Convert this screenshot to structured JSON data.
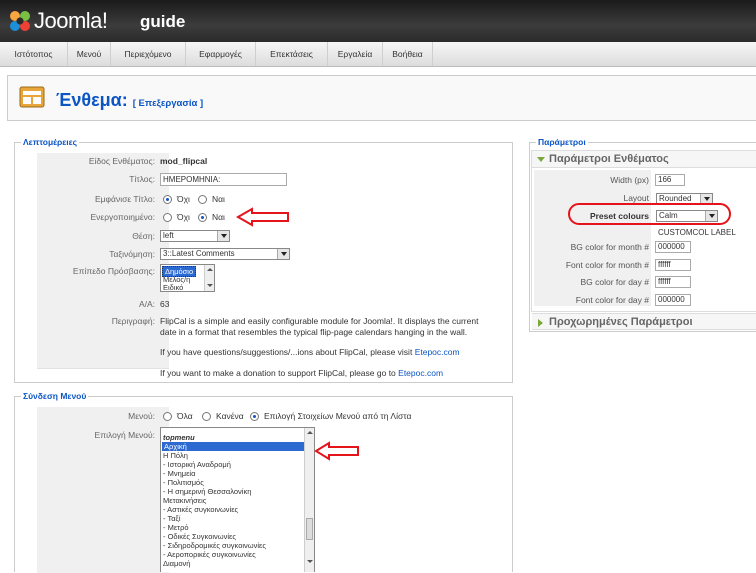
{
  "header": {
    "logo_text": "Joomla!",
    "site_title": "guide"
  },
  "menu": {
    "items": [
      "Ιστότοπος",
      "Μενού",
      "Περιεχόμενο",
      "Εφαρμογές",
      "Επεκτάσεις",
      "Εργαλεία",
      "Βοήθεια"
    ]
  },
  "toolbar": {
    "title": "Ένθεμα:",
    "subtitle": "[ Επεξεργασία ]"
  },
  "details": {
    "legend": "Λεπτομέρειες",
    "type_label": "Είδος Ενθέματος:",
    "type_value": "mod_flipcal",
    "title_label": "Τίτλος:",
    "title_value": "ΗΜΕΡΟΜΗΝΙΑ:",
    "show_title_label": "Εμφάνισε Τίτλο:",
    "enabled_label": "Ενεργοποιημένο:",
    "radio_no": "Όχι",
    "radio_yes": "Ναι",
    "position_label": "Θέση:",
    "position_value": "left",
    "order_label": "Ταξινόμηση:",
    "order_value": "3::Latest Comments",
    "access_label": "Επίπεδο Πρόσβασης:",
    "access_options": [
      "Δημόσιο",
      "Μέλος/η",
      "Ειδικό"
    ],
    "id_label": "A/A:",
    "id_value": "63",
    "desc_label": "Περιγραφή:",
    "desc_line1": "FlipCal is a simple and easily configurable module for Joomla!. It displays the current",
    "desc_line2": "date in a format that resembles the typical flip-page calendars hanging in the wall.",
    "desc_q_prefix": "If you have questions/suggestions/...ions about FlipCal, please visit ",
    "desc_donate_prefix": "If you want to make a donation to support FlipCal, please go to ",
    "link_text": "Etepoc.com"
  },
  "menu_link": {
    "legend": "Σύνδεση Μενού",
    "menus_label": "Μενού:",
    "opt_all": "Όλα",
    "opt_none": "Κανένα",
    "opt_select": "Επιλογή Στοιχείων Μενού από τη Λίστα",
    "select_label": "Επιλογή Μενού:",
    "list_top": "topmenu",
    "items": [
      "Αρχική",
      "Η Πόλη",
      "- Ιστορική Αναδρομή",
      "- Μνημεία",
      "- Πολιτισμός",
      "- Η σημερινή Θεσσαλονίκη",
      "Μετακινήσεις",
      "- Αστικές συγκοινωνίες",
      "- Ταξί",
      "- Μετρό",
      "- Οδικές Συγκοινωνίες",
      "- Σιδηροδρομικές συγκοινωνίες",
      "- Αεροπορικές συγκοινωνίες",
      "Διαμονή"
    ]
  },
  "params": {
    "legend": "Παράμετροι",
    "pane_title": "Παράμετροι Ενθέματος",
    "width_label": "Width (px)",
    "width_value": "166",
    "layout_label": "Layout",
    "layout_value": "Rounded",
    "preset_label": "Preset colours",
    "preset_value": "Calm",
    "customcol": "CUSTOMCOL LABEL",
    "bg_month_label": "BG color for month #",
    "bg_month_value": "000000",
    "font_month_label": "Font color for month #",
    "font_month_value": "ffffff",
    "bg_day_label": "BG color for day #",
    "bg_day_value": "ffffff",
    "font_day_label": "Font color for day #",
    "font_day_value": "000000",
    "advanced_title": "Προχωρημένες Παράμετροι"
  }
}
